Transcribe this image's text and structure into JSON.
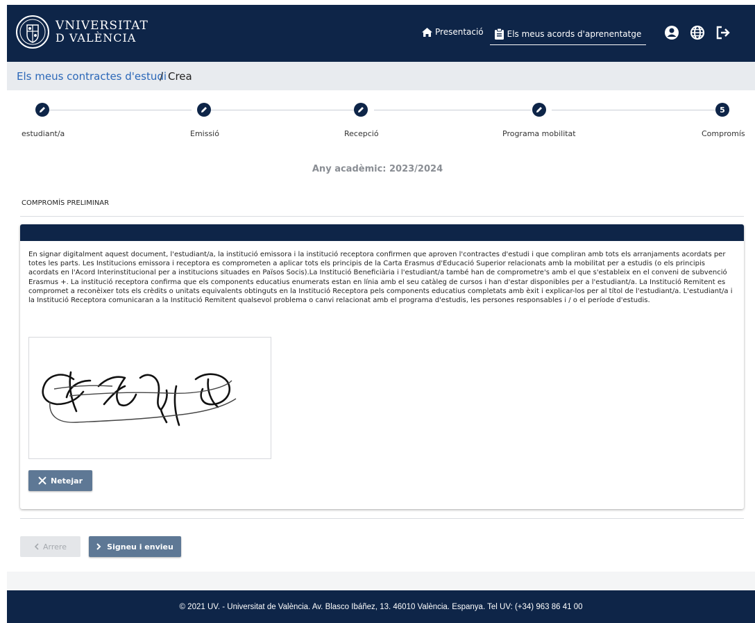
{
  "header": {
    "logo_line1": "VNIVERSITAT",
    "logo_line2": "D VALÈNCIA",
    "nav_home_label": "Presentació",
    "nav_agreements_label": "Els meus acords d'aprenentatge",
    "icons": [
      "home-icon",
      "clipboard-icon",
      "user-icon",
      "globe-icon",
      "logout-icon"
    ]
  },
  "breadcrumb": {
    "link": "Els meus contractes d'estudi",
    "separator": "/",
    "current": "Crea"
  },
  "stepper": {
    "steps": [
      {
        "label": "estudiant/a",
        "icon": "pencil-icon"
      },
      {
        "label": "Emissió",
        "icon": "pencil-icon"
      },
      {
        "label": "Recepció",
        "icon": "pencil-icon"
      },
      {
        "label": "Programa mobilitat",
        "icon": "pencil-icon"
      },
      {
        "label": "Compromís",
        "number": "5"
      }
    ]
  },
  "academic_year": "Any acadèmic: 2023/2024",
  "section_title": "COMPROMÍS PRELIMINAR",
  "commitment_text": "En signar digitalment aquest document, l'estudiant/a, la institució emissora i la institució receptora confirmen que aproven l'contractes d'estudi i que compliran amb tots els arranjaments acordats per totes les parts. Les Institucions emissora i receptora es comprometen a aplicar tots els principis de la Carta Erasmus d'Educació Superior relacionats amb la mobilitat per a estudis (o els principis acordats en l'Acord Interinstitucional per a institucions situades en Països Socis).La Institució Beneficiària i l'estudiant/a també han de comprometre's amb el que s'estableix en el conveni de subvenció Erasmus +. La institució receptora confirma que els components educatius enumerats estan en línia amb el seu catàleg de cursos i han d'estar disponibles per a l'estudiant/a. La Institució Remitent es compromet a reconèixer tots els crèdits o unitats equivalents obtinguts en la Institució Receptora pels components educatius completats amb èxit i explicar-los per al títol de l'estudiant/a. L'estudiant/a i la Institució Receptora comunicaran a la Institució Remitent qualsevol problema o canvi relacionat amb el programa d'estudis, les persones responsables i / o el període d'estudis.",
  "buttons": {
    "clear": "Netejar",
    "back": "Arrere",
    "sign_send": "Signeu i envieu"
  },
  "footer": "© 2021 UV. - Universitat de València. Av. Blasco Ibáñez, 13. 46010 València. Espanya. Tel UV: (+34) 963 86 41 00",
  "colors": {
    "navy": "#0e2548",
    "button": "#5e7895",
    "link": "#2a67b8"
  }
}
